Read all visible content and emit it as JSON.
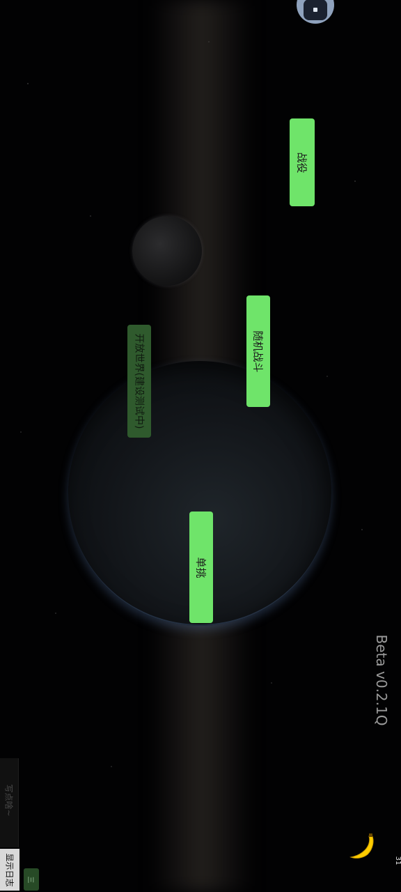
{
  "menu": {
    "campaign_label": "战役",
    "random_battle_label": "随机战斗",
    "open_world_label": "开放世界(建设测试中)",
    "duel_label": "单挑"
  },
  "version_label": "Beta v0.2.1Q",
  "status_bar": {
    "number": "31"
  },
  "log_panel": {
    "input_placeholder": "写点啥~",
    "show_log_label": "显示日志",
    "toggle_label": "三"
  },
  "colors": {
    "button_green": "#6fe46a",
    "button_disabled": "#2f5a2d",
    "background": "#020203"
  },
  "icons": [
    "avatar-icon",
    "banana-icon"
  ]
}
